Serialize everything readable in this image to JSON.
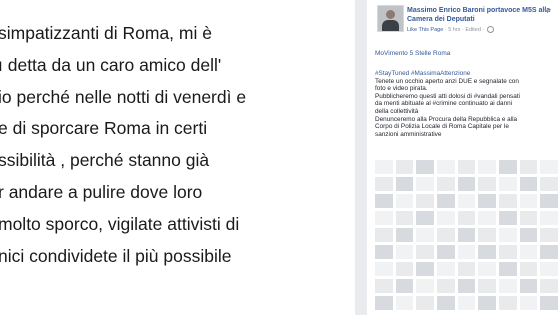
{
  "post_excerpt": {
    "lines": [
      "simpatizzanti di Roma, mi è",
      "ı detta da un caro amico dell'",
      "io perché nelle notti di venerdì e",
      "e di sporcare Roma in certi",
      "ssibilità , perché stanno già",
      "r andare a pulire dove loro",
      "molto sporco, vigilate attivisti di",
      "nici condividete il più possibile"
    ]
  },
  "sidebar_post": {
    "author": "Massimo Enrico Baroni portavoce M5S alla Camera dei Deputati",
    "meta": {
      "like_label": "Like This Page",
      "time": "5 hrs",
      "edited": "Edited"
    },
    "tagline": "MoVimento 5 Stelle Roma",
    "body_lines": [
      {
        "text": "#StayTuned #MassimaAttenzione",
        "link": true
      },
      {
        "text": "Tenete un occhio aperto anzi DUE e segnalate con",
        "link": false
      },
      {
        "text": "foto e video pirata.",
        "link": false
      },
      {
        "text": "Pubblicheremo questi atti dolosi di #vandali pensati",
        "link": false
      },
      {
        "text": "da menti abituate al #crimine continuato ai danni",
        "link": false
      },
      {
        "text": "della collettività",
        "link": false
      },
      {
        "text": "Denunceremo alla Procura della Repubblica e alla",
        "link": false
      },
      {
        "text": "Corpo di Polizia Locale di Roma Capitale per le",
        "link": false
      },
      {
        "text": "sanzioni amministrative",
        "link": false
      }
    ]
  },
  "icons": {
    "avatar": "profile-photo",
    "menu": "chevron-down-icon",
    "privacy": "globe-icon"
  }
}
